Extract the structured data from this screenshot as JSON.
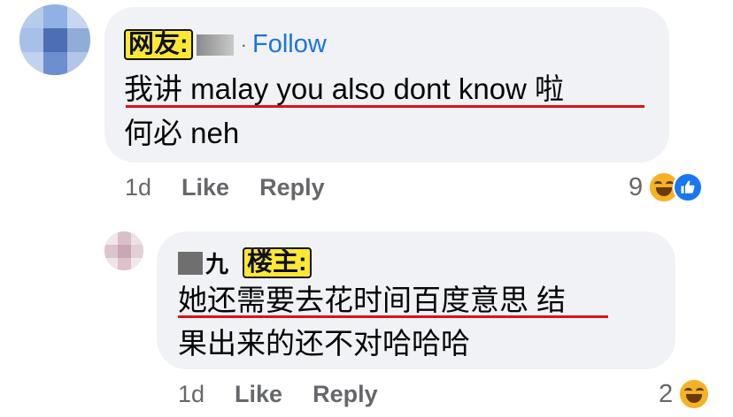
{
  "comments": [
    {
      "tag": "网友:",
      "follow_label": "Follow",
      "text_lines": [
        "我讲 malay you also dont know 啦",
        "何必 neh"
      ],
      "time": "1d",
      "like_label": "Like",
      "reply_label": "Reply",
      "reaction_count": "9"
    },
    {
      "name_char": "九",
      "tag": "楼主:",
      "text_lines": [
        "她还需要去花时间百度意思 结",
        "果出来的还不对哈哈哈"
      ],
      "time": "1d",
      "like_label": "Like",
      "reply_label": "Reply",
      "reaction_count": "2"
    }
  ],
  "colors": {
    "bubble": "#f0f2f5",
    "follow": "#1b74e4",
    "underline": "#d8131c",
    "tag_bg": "#ffe82e",
    "muted": "#65676b"
  },
  "icons": [
    "haha-emoji-icon",
    "like-reaction-icon"
  ]
}
